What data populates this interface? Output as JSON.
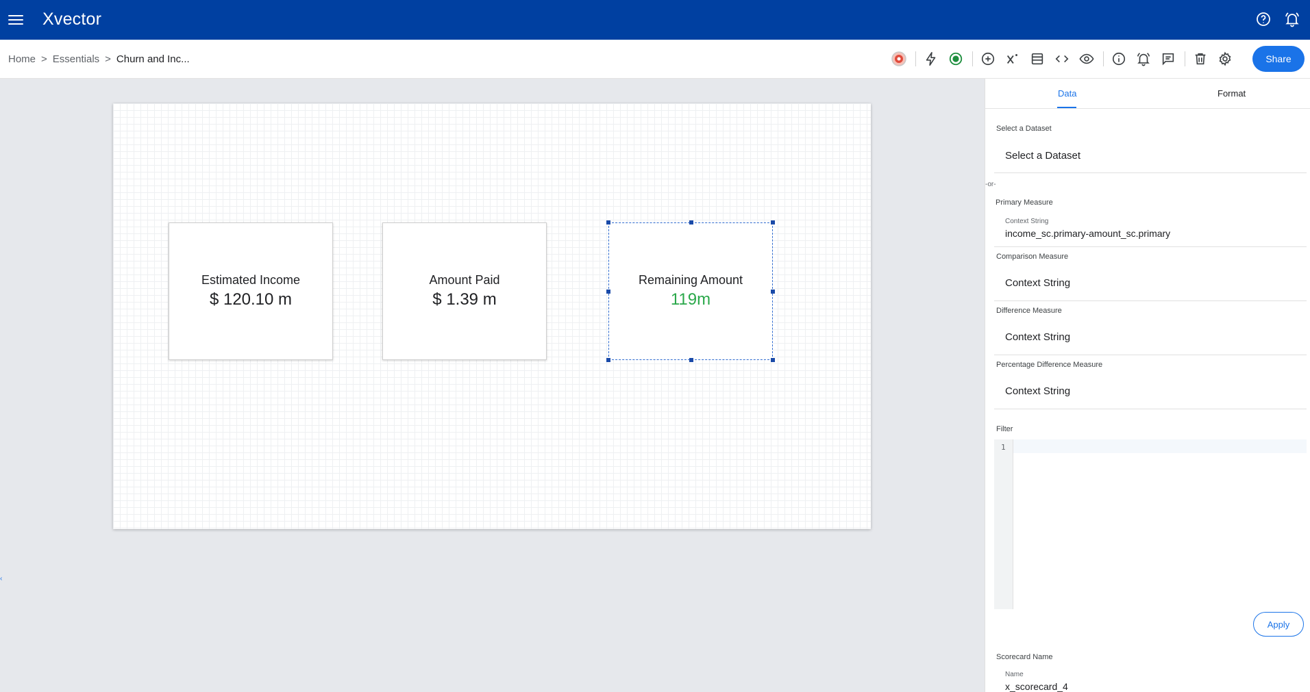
{
  "app": {
    "logo": "Xvector"
  },
  "breadcrumb": {
    "items": [
      "Home",
      "Essentials"
    ],
    "separator": ">",
    "current": "Churn and Inc..."
  },
  "toolbar": {
    "share_label": "Share"
  },
  "cards": [
    {
      "title": "Estimated Income",
      "value": "$ 120.10 m"
    },
    {
      "title": "Amount Paid",
      "value": "$ 1.39 m"
    },
    {
      "title": "Remaining Amount",
      "value": "119m",
      "value_color": "#2aa84a",
      "selected": true
    }
  ],
  "panel": {
    "tabs": [
      {
        "label": "Data",
        "active": true
      },
      {
        "label": "Format",
        "active": false
      }
    ],
    "dataset": {
      "label": "Select a Dataset",
      "placeholder": "Select a Dataset"
    },
    "or_text": "-or-",
    "primary_measure": {
      "label": "Primary Measure",
      "sub_label": "Context String",
      "value": "income_sc.primary-amount_sc.primary"
    },
    "comparison_measure": {
      "label": "Comparison Measure",
      "placeholder": "Context String"
    },
    "difference_measure": {
      "label": "Difference Measure",
      "placeholder": "Context String"
    },
    "percentage_difference_measure": {
      "label": "Percentage Difference Measure",
      "placeholder": "Context String"
    },
    "filter": {
      "label": "Filter",
      "line_number": "1"
    },
    "apply_label": "Apply",
    "scorecard_name": {
      "label": "Scorecard Name",
      "sub_label": "Name",
      "value": "x_scorecard_4"
    }
  },
  "colors": {
    "topbar": "#0040a1",
    "accent": "#1a73e8",
    "positive": "#2aa84a"
  },
  "icons": {
    "top": [
      "help-icon",
      "notification-bell-icon"
    ],
    "toolbar": [
      "user-avatar-icon",
      "lightning-icon",
      "record-status-icon",
      "add-circle-icon",
      "superscript-x-icon",
      "layout-icon",
      "code-icon",
      "preview-eye-icon",
      "info-icon",
      "alarm-icon",
      "comment-icon",
      "delete-icon",
      "settings-gear-icon"
    ]
  }
}
